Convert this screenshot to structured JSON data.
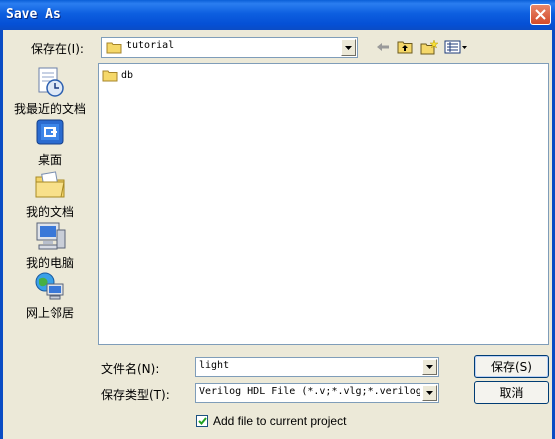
{
  "window": {
    "title": "Save As"
  },
  "toolbar": {
    "save_in_label": "保存在(I):",
    "save_in_value": "tutorial",
    "icons": [
      "back-arrow-icon",
      "up-folder-icon",
      "new-folder-icon",
      "view-menu-icon"
    ]
  },
  "places": [
    {
      "label": "我最近的文档",
      "icon": "recent-documents-icon"
    },
    {
      "label": "桌面",
      "icon": "desktop-icon"
    },
    {
      "label": "我的文档",
      "icon": "my-documents-icon"
    },
    {
      "label": "我的电脑",
      "icon": "my-computer-icon"
    },
    {
      "label": "网上邻居",
      "icon": "network-places-icon"
    }
  ],
  "files": [
    {
      "name": "db",
      "icon": "folder-icon"
    }
  ],
  "form": {
    "filename_label": "文件名(N):",
    "filename_value": "light",
    "filetype_label": "保存类型(T):",
    "filetype_value": "Verilog HDL File (*.v;*.vlg;*.verilog"
  },
  "buttons": {
    "save": "保存(S)",
    "cancel": "取消"
  },
  "checkbox": {
    "label": "Add file to current project",
    "checked": true
  }
}
